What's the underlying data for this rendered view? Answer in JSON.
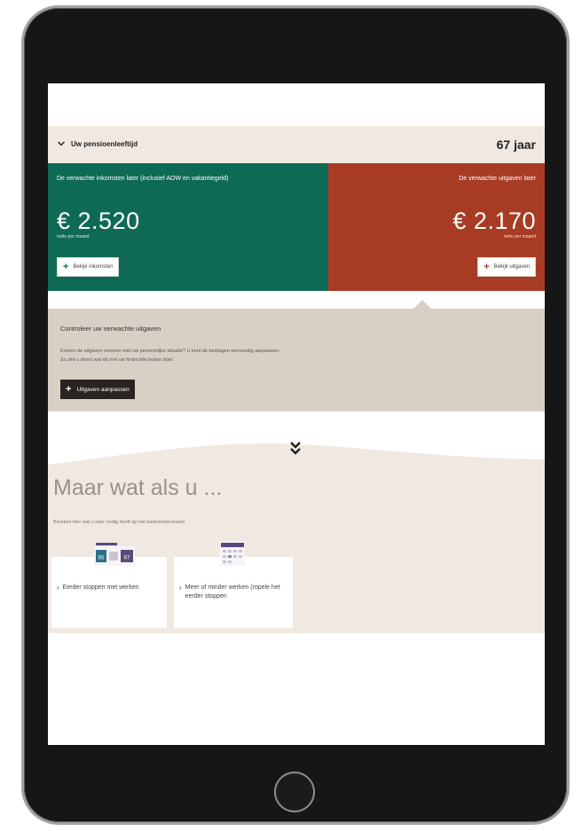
{
  "header": {
    "age_label": "Uw pensioenleeftijd",
    "age_value": "67 jaar"
  },
  "income": {
    "label": "De verwachte inkomsten later (inclusief AOW en vakantiegeld)",
    "amount": "€ 2.520",
    "sub": "netto per maand",
    "button": "Bekijk inkomsten",
    "color": "#0f6a55"
  },
  "expenses": {
    "label": "De verwachte uitgaven later",
    "amount": "€ 2.170",
    "sub": "netto per maand",
    "button": "Bekijk uitgaven",
    "color": "#a83b24"
  },
  "check": {
    "title": "Controleer uw verwachte uitgaven",
    "text_line1": "Komen de uitgaven overeen met uw persoonlijke situatie? U kunt de bedragen eenvoudig aanpassen.",
    "text_line2": "Zo ziet u direct wat dit met uw financiële buiten doet.",
    "button": "Uitgaven aanpassen"
  },
  "whatif": {
    "title": "Maar wat als u ...",
    "text": "Bereken hier wat u later nodig heeft op het toekomstscenario",
    "options": [
      {
        "label": "Eerder stoppen met werken",
        "icon": "calendar-age-icon",
        "icon_values": [
          "65",
          "67"
        ]
      },
      {
        "label": "Meer of minder werken (ropele het eerder stoppen",
        "icon": "calendar-icon"
      }
    ]
  }
}
